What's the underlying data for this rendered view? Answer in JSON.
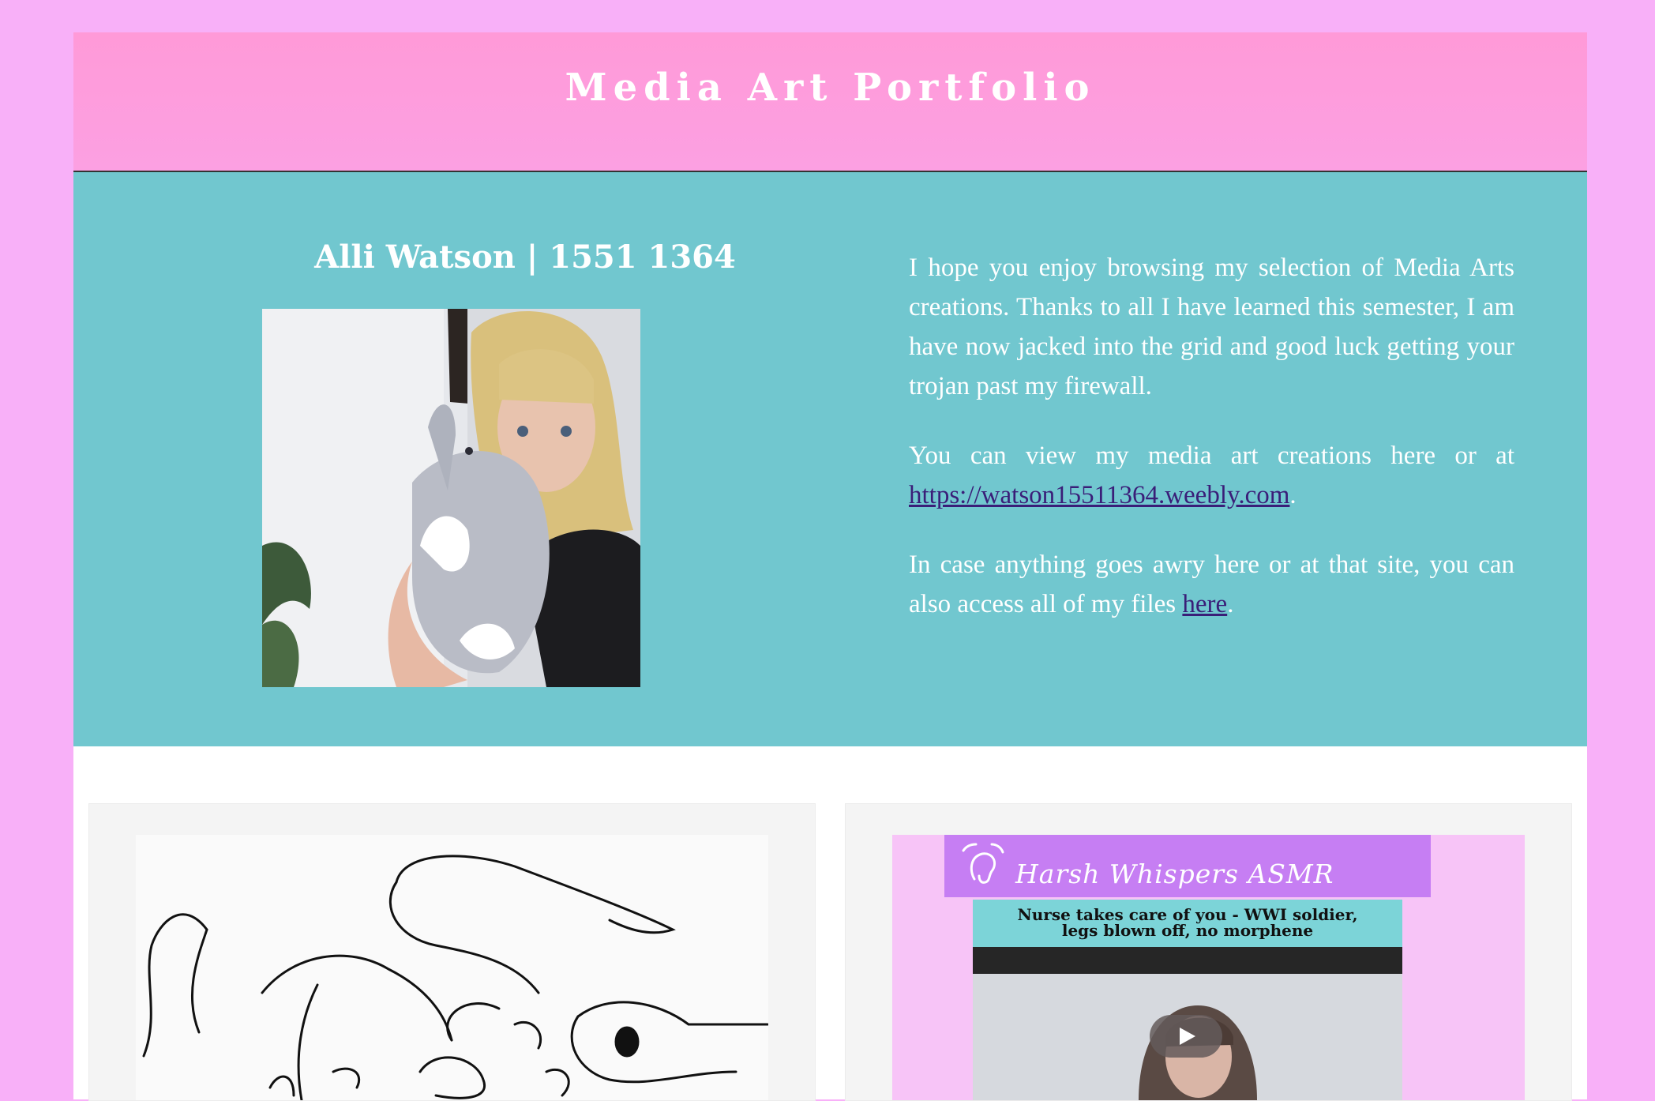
{
  "header": {
    "title": "Media Art Portfolio"
  },
  "intro": {
    "author": "Alli Watson | 1551 1364",
    "paragraphs": {
      "p1": "I hope you enjoy browsing my selection of Media Arts creations. Thanks to all I have learned this semester, I am have now jacked into the grid and good luck getting your trojan past my firewall.",
      "p2_prefix": "You can view my media art creations here or at ",
      "p2_link": "https://watson15511364.weebly.com",
      "p2_suffix": ".",
      "p3_prefix": "In case anything goes awry here or at that site, you can also access all of my files ",
      "p3_link": "here",
      "p3_suffix": "."
    }
  },
  "cards": {
    "video": {
      "channel_name": "Harsh Whispers ASMR",
      "video_title_line1": "Nurse takes care of you - WWI soldier,",
      "video_title_line2": "legs blown off, no morphene"
    }
  },
  "colors": {
    "background": "#f8b0f8",
    "header": "#ff9ad8",
    "intro": "#71c7cf",
    "link": "#3a1e78",
    "channel_banner": "#c67ef3"
  },
  "icons": {
    "play": "play-icon",
    "logo": "ear-logo-icon"
  }
}
